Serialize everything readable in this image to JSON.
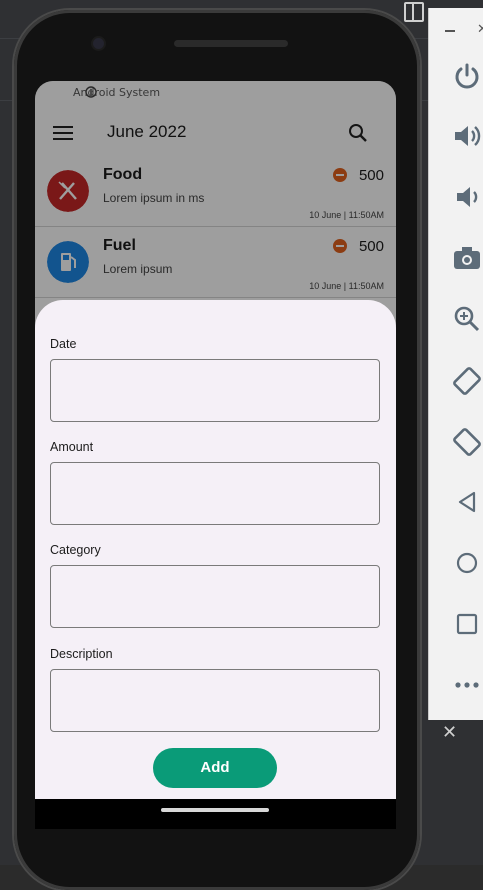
{
  "status_bar": {
    "notification_text": "Android System"
  },
  "app_bar": {
    "title": "June 2022"
  },
  "transactions": [
    {
      "title": "Food",
      "description": "Lorem ipsum in ms",
      "amount": "500",
      "timestamp": "10 June | 11:50AM",
      "icon": "utensils-icon",
      "icon_color": "#c62828"
    },
    {
      "title": "Fuel",
      "description": "Lorem ipsum",
      "amount": "500",
      "timestamp": "10 June | 11:50AM",
      "icon": "fuel-pump-icon",
      "icon_color": "#1e88e5"
    }
  ],
  "form": {
    "fields": [
      {
        "label": "Date",
        "value": ""
      },
      {
        "label": "Amount",
        "value": ""
      },
      {
        "label": "Category",
        "value": ""
      },
      {
        "label": "Description",
        "value": ""
      }
    ],
    "submit_label": "Add"
  },
  "colors": {
    "accent": "#0a9b78",
    "expense": "#e2621d",
    "sheet_bg": "#f5f0f7"
  },
  "emulator_toolbar": [
    "power-icon",
    "volume-up-icon",
    "volume-down-icon",
    "camera-icon",
    "zoom-in-icon",
    "rotate-left-icon",
    "rotate-right-icon",
    "back-icon",
    "home-icon",
    "overview-icon",
    "more-icon"
  ]
}
